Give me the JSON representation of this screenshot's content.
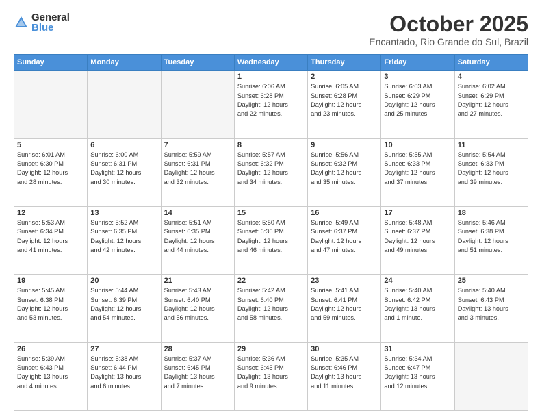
{
  "logo": {
    "general": "General",
    "blue": "Blue"
  },
  "header": {
    "month": "October 2025",
    "location": "Encantado, Rio Grande do Sul, Brazil"
  },
  "weekdays": [
    "Sunday",
    "Monday",
    "Tuesday",
    "Wednesday",
    "Thursday",
    "Friday",
    "Saturday"
  ],
  "weeks": [
    [
      {
        "day": "",
        "text": ""
      },
      {
        "day": "",
        "text": ""
      },
      {
        "day": "",
        "text": ""
      },
      {
        "day": "1",
        "text": "Sunrise: 6:06 AM\nSunset: 6:28 PM\nDaylight: 12 hours\nand 22 minutes."
      },
      {
        "day": "2",
        "text": "Sunrise: 6:05 AM\nSunset: 6:28 PM\nDaylight: 12 hours\nand 23 minutes."
      },
      {
        "day": "3",
        "text": "Sunrise: 6:03 AM\nSunset: 6:29 PM\nDaylight: 12 hours\nand 25 minutes."
      },
      {
        "day": "4",
        "text": "Sunrise: 6:02 AM\nSunset: 6:29 PM\nDaylight: 12 hours\nand 27 minutes."
      }
    ],
    [
      {
        "day": "5",
        "text": "Sunrise: 6:01 AM\nSunset: 6:30 PM\nDaylight: 12 hours\nand 28 minutes."
      },
      {
        "day": "6",
        "text": "Sunrise: 6:00 AM\nSunset: 6:31 PM\nDaylight: 12 hours\nand 30 minutes."
      },
      {
        "day": "7",
        "text": "Sunrise: 5:59 AM\nSunset: 6:31 PM\nDaylight: 12 hours\nand 32 minutes."
      },
      {
        "day": "8",
        "text": "Sunrise: 5:57 AM\nSunset: 6:32 PM\nDaylight: 12 hours\nand 34 minutes."
      },
      {
        "day": "9",
        "text": "Sunrise: 5:56 AM\nSunset: 6:32 PM\nDaylight: 12 hours\nand 35 minutes."
      },
      {
        "day": "10",
        "text": "Sunrise: 5:55 AM\nSunset: 6:33 PM\nDaylight: 12 hours\nand 37 minutes."
      },
      {
        "day": "11",
        "text": "Sunrise: 5:54 AM\nSunset: 6:33 PM\nDaylight: 12 hours\nand 39 minutes."
      }
    ],
    [
      {
        "day": "12",
        "text": "Sunrise: 5:53 AM\nSunset: 6:34 PM\nDaylight: 12 hours\nand 41 minutes."
      },
      {
        "day": "13",
        "text": "Sunrise: 5:52 AM\nSunset: 6:35 PM\nDaylight: 12 hours\nand 42 minutes."
      },
      {
        "day": "14",
        "text": "Sunrise: 5:51 AM\nSunset: 6:35 PM\nDaylight: 12 hours\nand 44 minutes."
      },
      {
        "day": "15",
        "text": "Sunrise: 5:50 AM\nSunset: 6:36 PM\nDaylight: 12 hours\nand 46 minutes."
      },
      {
        "day": "16",
        "text": "Sunrise: 5:49 AM\nSunset: 6:37 PM\nDaylight: 12 hours\nand 47 minutes."
      },
      {
        "day": "17",
        "text": "Sunrise: 5:48 AM\nSunset: 6:37 PM\nDaylight: 12 hours\nand 49 minutes."
      },
      {
        "day": "18",
        "text": "Sunrise: 5:46 AM\nSunset: 6:38 PM\nDaylight: 12 hours\nand 51 minutes."
      }
    ],
    [
      {
        "day": "19",
        "text": "Sunrise: 5:45 AM\nSunset: 6:38 PM\nDaylight: 12 hours\nand 53 minutes."
      },
      {
        "day": "20",
        "text": "Sunrise: 5:44 AM\nSunset: 6:39 PM\nDaylight: 12 hours\nand 54 minutes."
      },
      {
        "day": "21",
        "text": "Sunrise: 5:43 AM\nSunset: 6:40 PM\nDaylight: 12 hours\nand 56 minutes."
      },
      {
        "day": "22",
        "text": "Sunrise: 5:42 AM\nSunset: 6:40 PM\nDaylight: 12 hours\nand 58 minutes."
      },
      {
        "day": "23",
        "text": "Sunrise: 5:41 AM\nSunset: 6:41 PM\nDaylight: 12 hours\nand 59 minutes."
      },
      {
        "day": "24",
        "text": "Sunrise: 5:40 AM\nSunset: 6:42 PM\nDaylight: 13 hours\nand 1 minute."
      },
      {
        "day": "25",
        "text": "Sunrise: 5:40 AM\nSunset: 6:43 PM\nDaylight: 13 hours\nand 3 minutes."
      }
    ],
    [
      {
        "day": "26",
        "text": "Sunrise: 5:39 AM\nSunset: 6:43 PM\nDaylight: 13 hours\nand 4 minutes."
      },
      {
        "day": "27",
        "text": "Sunrise: 5:38 AM\nSunset: 6:44 PM\nDaylight: 13 hours\nand 6 minutes."
      },
      {
        "day": "28",
        "text": "Sunrise: 5:37 AM\nSunset: 6:45 PM\nDaylight: 13 hours\nand 7 minutes."
      },
      {
        "day": "29",
        "text": "Sunrise: 5:36 AM\nSunset: 6:45 PM\nDaylight: 13 hours\nand 9 minutes."
      },
      {
        "day": "30",
        "text": "Sunrise: 5:35 AM\nSunset: 6:46 PM\nDaylight: 13 hours\nand 11 minutes."
      },
      {
        "day": "31",
        "text": "Sunrise: 5:34 AM\nSunset: 6:47 PM\nDaylight: 13 hours\nand 12 minutes."
      },
      {
        "day": "",
        "text": ""
      }
    ]
  ]
}
